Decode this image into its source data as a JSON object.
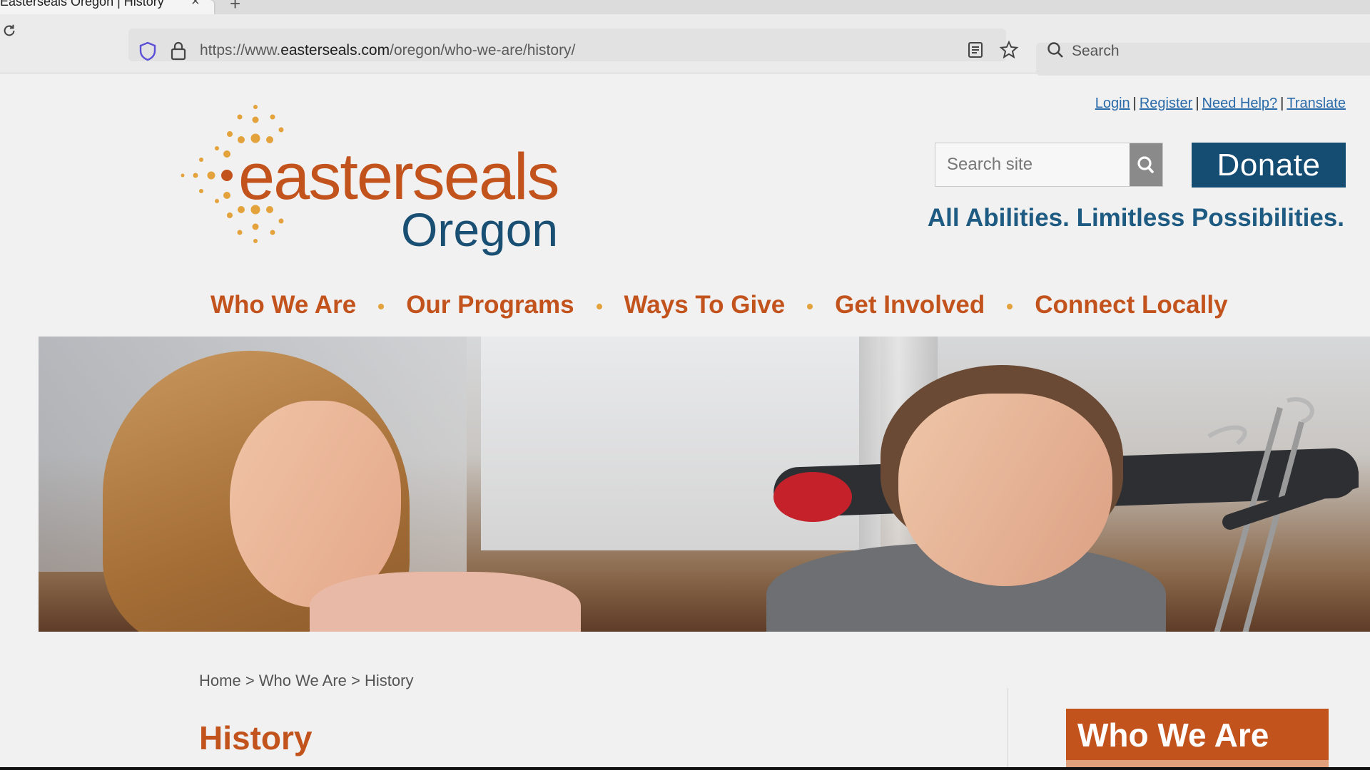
{
  "browser": {
    "tab_title": "Easterseals Oregon | History",
    "tab_close": "×",
    "new_tab": "+",
    "url_prefix": "https://www.",
    "url_domain": "easterseals.com",
    "url_path": "/oregon/who-we-are/history/",
    "search_label": "Search",
    "icons": [
      "reload-icon",
      "shield-icon",
      "lock-icon",
      "reader-view-icon",
      "bookmark-star-icon",
      "search-icon"
    ]
  },
  "header": {
    "links": [
      "Login",
      "Register",
      "Need Help?",
      "Translate"
    ],
    "link_separator": "|",
    "logo_word": "easterseals",
    "logo_sub": "Oregon",
    "search_placeholder": "Search site",
    "donate_label": "Donate",
    "tagline": "All Abilities. Limitless Possibilities."
  },
  "nav": {
    "items": [
      "Who We Are",
      "Our Programs",
      "Ways To Give",
      "Get Involved",
      "Connect Locally"
    ]
  },
  "content": {
    "breadcrumb": [
      "Home",
      "Who We Are",
      "History"
    ],
    "breadcrumb_separator": ">",
    "page_title": "History",
    "sidebar_title": "Who We Are"
  },
  "colors": {
    "brand_orange": "#c3531d",
    "brand_blue": "#154d72",
    "accent_gold": "#e3a23b",
    "link_blue": "#2a6aa8"
  }
}
